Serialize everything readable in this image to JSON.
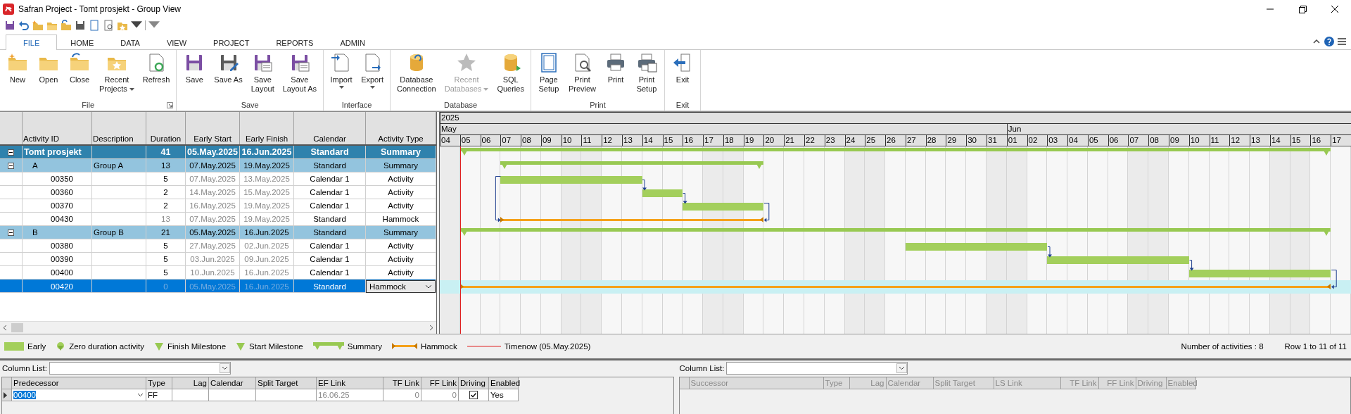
{
  "window": {
    "title": "Safran Project - Tomt prosjekt - Group View"
  },
  "ribbon_tabs": [
    {
      "label": "FILE",
      "selected": true
    },
    {
      "label": "HOME",
      "selected": false
    },
    {
      "label": "DATA",
      "selected": false
    },
    {
      "label": "VIEW",
      "selected": false
    },
    {
      "label": "PROJECT",
      "selected": false
    },
    {
      "label": "REPORTS",
      "selected": false
    },
    {
      "label": "ADMIN",
      "selected": false
    }
  ],
  "ribbon_groups": [
    {
      "label": "File",
      "launcher": true,
      "buttons": [
        {
          "label": "New",
          "dropdown": false,
          "disabled": false
        },
        {
          "label": "Open",
          "dropdown": false,
          "disabled": false
        },
        {
          "label": "Close",
          "dropdown": false,
          "disabled": false
        },
        {
          "label": "Recent\nProjects",
          "dropdown": true,
          "disabled": false
        },
        {
          "label": "Refresh",
          "dropdown": false,
          "disabled": false
        }
      ]
    },
    {
      "label": "Save",
      "launcher": false,
      "buttons": [
        {
          "label": "Save",
          "dropdown": false,
          "disabled": false
        },
        {
          "label": "Save As",
          "dropdown": false,
          "disabled": false
        },
        {
          "label": "Save\nLayout",
          "dropdown": false,
          "disabled": false
        },
        {
          "label": "Save\nLayout As",
          "dropdown": false,
          "disabled": false
        }
      ]
    },
    {
      "label": "Interface",
      "launcher": false,
      "buttons": [
        {
          "label": "Import",
          "dropdown": true,
          "disabled": false
        },
        {
          "label": "Export",
          "dropdown": true,
          "disabled": false
        }
      ]
    },
    {
      "label": "Database",
      "launcher": false,
      "buttons": [
        {
          "label": "Database\nConnection",
          "dropdown": false,
          "disabled": false
        },
        {
          "label": "Recent\nDatabases",
          "dropdown": true,
          "disabled": true
        },
        {
          "label": "SQL\nQueries",
          "dropdown": false,
          "disabled": false
        }
      ]
    },
    {
      "label": "Print",
      "launcher": false,
      "buttons": [
        {
          "label": "Page\nSetup",
          "dropdown": false,
          "disabled": false
        },
        {
          "label": "Print\nPreview",
          "dropdown": false,
          "disabled": false
        },
        {
          "label": "Print",
          "dropdown": false,
          "disabled": false
        },
        {
          "label": "Print\nSetup",
          "dropdown": false,
          "disabled": false
        }
      ]
    },
    {
      "label": "Exit",
      "launcher": false,
      "buttons": [
        {
          "label": "Exit",
          "dropdown": false,
          "disabled": false
        }
      ]
    }
  ],
  "table": {
    "columns": [
      {
        "label": "Activity ID"
      },
      {
        "label": "Description"
      },
      {
        "label": "Duration"
      },
      {
        "label": "Early Start"
      },
      {
        "label": "Early Finish"
      },
      {
        "label": "Calendar"
      },
      {
        "label": "Activity Type"
      }
    ],
    "rows": [
      {
        "kind": "project",
        "expanded": true,
        "selected": false,
        "activity_id": "Tomt prosjekt",
        "duration": "41",
        "early_start": "05.May.2025",
        "early_finish": "16.Jun.2025",
        "calendar": "Standard",
        "activity_type": "Summary",
        "children": [
          {
            "kind": "group",
            "expanded": true,
            "selected": false,
            "activity_id": "A",
            "description": "Group A",
            "duration": "13",
            "early_start": "07.May.2025",
            "early_finish": "19.May.2025",
            "calendar": "Standard",
            "activity_type": "Summary",
            "children": [
              {
                "kind": "activity",
                "selected": false,
                "activity_id": "00350",
                "duration": "5",
                "early_start": "07.May.2025",
                "early_finish": "13.May.2025",
                "calendar": "Calendar 1",
                "activity_type": "Activity"
              },
              {
                "kind": "activity",
                "selected": false,
                "activity_id": "00360",
                "duration": "2",
                "early_start": "14.May.2025",
                "early_finish": "15.May.2025",
                "calendar": "Calendar 1",
                "activity_type": "Activity"
              },
              {
                "kind": "activity",
                "selected": false,
                "activity_id": "00370",
                "duration": "2",
                "early_start": "16.May.2025",
                "early_finish": "19.May.2025",
                "calendar": "Calendar 1",
                "activity_type": "Activity"
              },
              {
                "kind": "hammock",
                "selected": false,
                "activity_id": "00430",
                "duration": "13",
                "early_start": "07.May.2025",
                "early_finish": "19.May.2025",
                "calendar": "Standard",
                "activity_type": "Hammock"
              }
            ]
          },
          {
            "kind": "group",
            "expanded": true,
            "selected": false,
            "activity_id": "B",
            "description": "Group B",
            "duration": "21",
            "early_start": "05.May.2025",
            "early_finish": "16.Jun.2025",
            "calendar": "Standard",
            "activity_type": "Summary",
            "children": [
              {
                "kind": "activity",
                "selected": false,
                "activity_id": "00380",
                "duration": "5",
                "early_start": "27.May.2025",
                "early_finish": "02.Jun.2025",
                "calendar": "Calendar 1",
                "activity_type": "Activity"
              },
              {
                "kind": "activity",
                "selected": false,
                "activity_id": "00390",
                "duration": "5",
                "early_start": "03.Jun.2025",
                "early_finish": "09.Jun.2025",
                "calendar": "Calendar 1",
                "activity_type": "Activity"
              },
              {
                "kind": "activity",
                "selected": false,
                "activity_id": "00400",
                "duration": "5",
                "early_start": "10.Jun.2025",
                "early_finish": "16.Jun.2025",
                "calendar": "Calendar 1",
                "activity_type": "Activity"
              },
              {
                "kind": "hammock",
                "selected": true,
                "activity_id": "00420",
                "duration": "0",
                "early_start": "05.May.2025",
                "early_finish": "16.Jun.2025",
                "calendar": "Standard",
                "activity_type": "Hammock"
              }
            ]
          }
        ]
      }
    ]
  },
  "gantt": {
    "year": "2025",
    "months": [
      {
        "label": "May",
        "days": [
          "04",
          "05",
          "06",
          "07",
          "08",
          "09",
          "10",
          "11",
          "12",
          "13",
          "14",
          "15",
          "16",
          "17",
          "18",
          "19",
          "20",
          "21",
          "22",
          "23",
          "24",
          "25",
          "26",
          "27",
          "28",
          "29",
          "30",
          "31"
        ]
      },
      {
        "label": "Jun",
        "days": [
          "01",
          "02",
          "03",
          "04",
          "05",
          "06",
          "07",
          "08",
          "09",
          "10",
          "11",
          "12",
          "13",
          "14",
          "15",
          "16",
          "17"
        ]
      }
    ]
  },
  "legend": [
    {
      "kind": "early",
      "label": "Early"
    },
    {
      "kind": "zero_duration",
      "label": "Zero duration activity"
    },
    {
      "kind": "finish_milestone",
      "label": "Finish Milestone"
    },
    {
      "kind": "start_milestone",
      "label": "Start Milestone"
    },
    {
      "kind": "summary",
      "label": "Summary"
    },
    {
      "kind": "hammock",
      "label": "Hammock"
    },
    {
      "kind": "timenow",
      "label": "Timenow (05.May.2025)"
    }
  ],
  "status": {
    "activity_count": "Number of activities : 8",
    "row_range": "Row 1 to 11 of 11"
  },
  "panels": [
    {
      "column_list_label": "Column List:",
      "disabled": false,
      "columns": [
        {
          "label": "Predecessor"
        },
        {
          "label": "Type"
        },
        {
          "label": "Lag"
        },
        {
          "label": "Calendar"
        },
        {
          "label": "Split Target"
        },
        {
          "label": "EF Link"
        },
        {
          "label": "TF Link"
        },
        {
          "label": "FF Link"
        },
        {
          "label": "Driving"
        },
        {
          "label": "Enabled"
        }
      ],
      "rows": [
        {
          "link": "00400",
          "type": "FF",
          "link_date": "16.06.25",
          "tf_link": "0",
          "ff_link": "0",
          "driving": true,
          "enabled": "Yes"
        }
      ]
    },
    {
      "column_list_label": "Column List:",
      "disabled": true,
      "columns": [
        {
          "label": "Successor"
        },
        {
          "label": "Type"
        },
        {
          "label": "Lag"
        },
        {
          "label": "Calendar"
        },
        {
          "label": "Split Target"
        },
        {
          "label": "LS Link"
        },
        {
          "label": "TF Link"
        },
        {
          "label": "FF Link"
        },
        {
          "label": "Driving"
        },
        {
          "label": "Enabled"
        }
      ]
    }
  ]
}
